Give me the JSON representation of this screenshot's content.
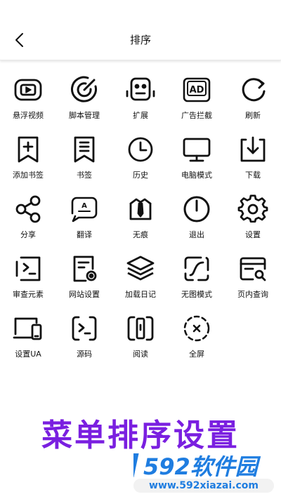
{
  "header": {
    "title": "排序"
  },
  "menu": {
    "items": [
      {
        "label": "悬浮视频",
        "icon": "floating-video-icon"
      },
      {
        "label": "脚本管理",
        "icon": "script-target-icon"
      },
      {
        "label": "扩展",
        "icon": "robot-extension-icon"
      },
      {
        "label": "广告拦截",
        "icon": "ad-block-icon"
      },
      {
        "label": "刷新",
        "icon": "refresh-icon"
      },
      {
        "label": "添加书签",
        "icon": "add-bookmark-icon"
      },
      {
        "label": "书签",
        "icon": "bookmark-icon"
      },
      {
        "label": "历史",
        "icon": "history-clock-icon"
      },
      {
        "label": "电脑模式",
        "icon": "desktop-monitor-icon"
      },
      {
        "label": "下载",
        "icon": "download-icon"
      },
      {
        "label": "分享",
        "icon": "share-icon"
      },
      {
        "label": "翻译",
        "icon": "translate-icon"
      },
      {
        "label": "无痕",
        "icon": "incognito-tie-icon"
      },
      {
        "label": "退出",
        "icon": "power-icon"
      },
      {
        "label": "设置",
        "icon": "gear-icon"
      },
      {
        "label": "审查元素",
        "icon": "terminal-icon"
      },
      {
        "label": "网站设置",
        "icon": "site-settings-icon"
      },
      {
        "label": "加载日记",
        "icon": "layers-icon"
      },
      {
        "label": "无图模式",
        "icon": "no-image-icon"
      },
      {
        "label": "页内查询",
        "icon": "find-in-page-icon"
      },
      {
        "label": "设置UA",
        "icon": "user-agent-icon"
      },
      {
        "label": "源码",
        "icon": "source-code-icon"
      },
      {
        "label": "阅读",
        "icon": "reader-icon"
      },
      {
        "label": "全屏",
        "icon": "fullscreen-icon"
      }
    ]
  },
  "banner": {
    "text": "菜单排序设置"
  },
  "watermark": {
    "brand": "592软件园",
    "url": "www.592xiazai.com"
  },
  "colors": {
    "banner": "#7a1fe0",
    "watermark_blue": "#1f7de0"
  }
}
